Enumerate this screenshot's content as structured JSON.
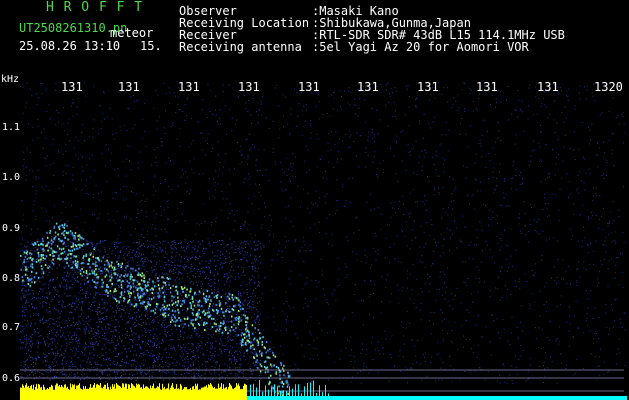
{
  "header": {
    "app_name": "H R O F F T",
    "file_name": "UT2508261310.pn",
    "type_label": "meteor",
    "datetime": "25.08.26 13:10",
    "seconds": "15.",
    "fields": [
      {
        "label": "Observer",
        "value": ":Masaki Kano"
      },
      {
        "label": "Receiving Location",
        "value": ":Shibukawa,Gunma,Japan"
      },
      {
        "label": "Receiver",
        "value": ":RTL-SDR SDR# 43dB L15 114.1MHz USB"
      },
      {
        "label": "Receiving antenna",
        "value": ":5el Yagi Az 20 for Aomori VOR"
      }
    ]
  },
  "spectrogram": {
    "y_unit": "kHz",
    "y_ticks": [
      "1.1",
      "1.0",
      "0.9",
      "0.8",
      "0.7",
      "0.6"
    ],
    "time_ticks": [
      "131",
      "131",
      "131",
      "131",
      "131",
      "131",
      "131",
      "131",
      "131",
      "1320"
    ],
    "colors": {
      "background": "#000000",
      "noise": "#1a2a8a",
      "echo": "#4fd0e0",
      "yellow": "#ffff00",
      "cyan": "#00ffff"
    }
  }
}
